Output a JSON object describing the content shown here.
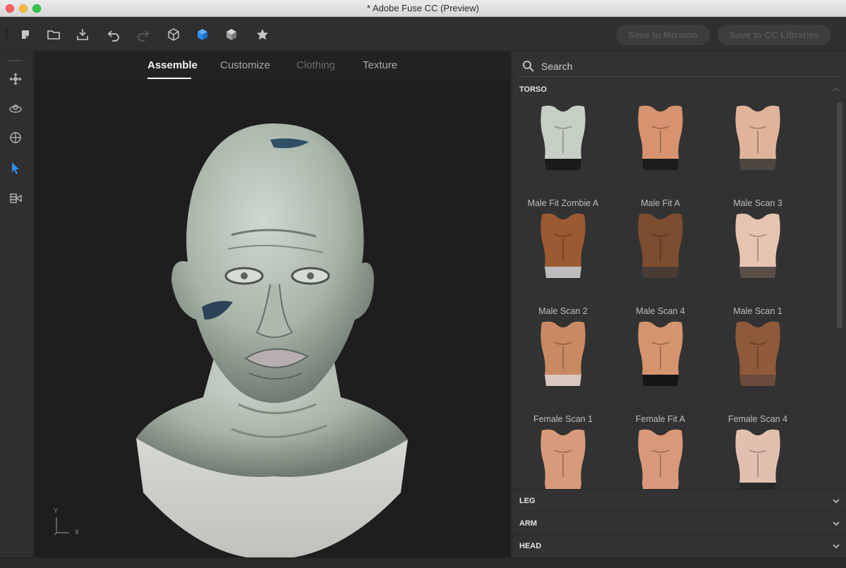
{
  "window": {
    "title": "* Adobe Fuse CC (Preview)"
  },
  "toolbar": {
    "save_mixamo_label": "Save to Mixamo",
    "save_cc_label": "Save to CC Libraries",
    "accent_color": "#2d8ceb",
    "icons": [
      "new-file-icon",
      "open-folder-icon",
      "import-icon",
      "undo-icon",
      "redo-icon",
      "cube-icon",
      "cube-solid-icon",
      "cube-shaded-icon",
      "star-icon"
    ]
  },
  "left_tools": [
    "move-icon",
    "orbit-icon",
    "target-icon",
    "select-pointer-icon",
    "camera-icon"
  ],
  "tabs": [
    {
      "label": "Assemble",
      "state": "active"
    },
    {
      "label": "Customize",
      "state": "normal"
    },
    {
      "label": "Clothing",
      "state": "disabled"
    },
    {
      "label": "Texture",
      "state": "normal"
    }
  ],
  "axes": {
    "y": "Y",
    "x": "X"
  },
  "search": {
    "placeholder": "Search"
  },
  "sections": {
    "torso": "TORSO",
    "leg": "LEG",
    "arm": "ARM",
    "head": "HEAD"
  },
  "torso_items": [
    {
      "label": "Male Fit Zombie A",
      "skin": "#c6cfc3",
      "bottom": "#1a1a1a"
    },
    {
      "label": "Male Fit A",
      "skin": "#d7936f",
      "bottom": "#1c1c1c"
    },
    {
      "label": "Male Scan 3",
      "skin": "#e0b49a",
      "bottom": "#4e4640"
    },
    {
      "label": "Male Scan 2",
      "skin": "#9c5a33",
      "bottom": "#bdbdbd"
    },
    {
      "label": "Male Scan 4",
      "skin": "#7d4d30",
      "bottom": "#4a3b34"
    },
    {
      "label": "Male Scan 1",
      "skin": "#e6c4b2",
      "bottom": "#5a4e48"
    },
    {
      "label": "Female Scan 1",
      "skin": "#c98a63",
      "bottom": "#d8c8c0"
    },
    {
      "label": "Female Fit A",
      "skin": "#d5946e",
      "bottom": "#151515"
    },
    {
      "label": "Female Scan 4",
      "skin": "#8e5a3a",
      "bottom": "#6a4a3a"
    },
    {
      "label": "",
      "skin": "#d79a7a",
      "bottom": "#d79a7a"
    },
    {
      "label": "",
      "skin": "#d8997a",
      "bottom": "#d8997a"
    },
    {
      "label": "",
      "skin": "#e2c0b0",
      "bottom": "#2a2a2a"
    }
  ]
}
